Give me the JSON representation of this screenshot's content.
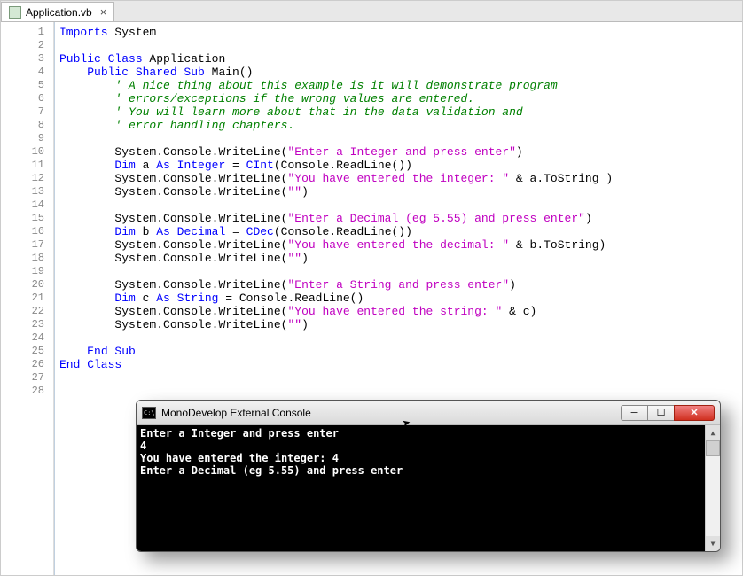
{
  "tab": {
    "filename": "Application.vb",
    "close_symbol": "×"
  },
  "line_numbers": [
    "1",
    "2",
    "3",
    "4",
    "5",
    "6",
    "7",
    "8",
    "9",
    "10",
    "11",
    "12",
    "13",
    "14",
    "15",
    "16",
    "17",
    "18",
    "19",
    "20",
    "21",
    "22",
    "23",
    "24",
    "25",
    "26",
    "27",
    "28"
  ],
  "code": {
    "l1": {
      "kw1": "Imports",
      "p1": " System"
    },
    "l3": {
      "kw1": "Public Class",
      "p1": " Application"
    },
    "l4": {
      "indent": "    ",
      "kw1": "Public Shared Sub",
      "p1": " Main()"
    },
    "l5": {
      "indent": "        ",
      "cm": "' A nice thing about this example is it will demonstrate program"
    },
    "l6": {
      "indent": "        ",
      "cm": "' errors/exceptions if the wrong values are entered."
    },
    "l7": {
      "indent": "        ",
      "cm": "' You will learn more about that in the data validation and"
    },
    "l8": {
      "indent": "        ",
      "cm": "' error handling chapters."
    },
    "l10": {
      "indent": "        ",
      "p1": "System.Console.WriteLine(",
      "s1": "\"Enter a Integer and press enter\"",
      "p2": ")"
    },
    "l11": {
      "indent": "        ",
      "kw1": "Dim",
      "p1": " a ",
      "kw2": "As Integer",
      "p2": " = ",
      "kw3": "CInt",
      "p3": "(Console.ReadLine())"
    },
    "l12": {
      "indent": "        ",
      "p1": "System.Console.WriteLine(",
      "s1": "\"You have entered the integer: \"",
      "p2": " & a.ToString )"
    },
    "l13": {
      "indent": "        ",
      "p1": "System.Console.WriteLine(",
      "s1": "\"\"",
      "p2": ")"
    },
    "l15": {
      "indent": "        ",
      "p1": "System.Console.WriteLine(",
      "s1": "\"Enter a Decimal (eg 5.55) and press enter\"",
      "p2": ")"
    },
    "l16": {
      "indent": "        ",
      "kw1": "Dim",
      "p1": " b ",
      "kw2": "As Decimal",
      "p2": " = ",
      "kw3": "CDec",
      "p3": "(Console.ReadLine())"
    },
    "l17": {
      "indent": "        ",
      "p1": "System.Console.WriteLine(",
      "s1": "\"You have entered the decimal: \"",
      "p2": " & b.ToString)"
    },
    "l18": {
      "indent": "        ",
      "p1": "System.Console.WriteLine(",
      "s1": "\"\"",
      "p2": ")"
    },
    "l20": {
      "indent": "        ",
      "p1": "System.Console.WriteLine(",
      "s1": "\"Enter a String and press enter\"",
      "p2": ")"
    },
    "l21": {
      "indent": "        ",
      "kw1": "Dim",
      "p1": " c ",
      "kw2": "As String",
      "p2": " = Console.ReadLine()"
    },
    "l22": {
      "indent": "        ",
      "p1": "System.Console.WriteLine(",
      "s1": "\"You have entered the string: \"",
      "p2": " & c)"
    },
    "l23": {
      "indent": "        ",
      "p1": "System.Console.WriteLine(",
      "s1": "\"\"",
      "p2": ")"
    },
    "l25": {
      "indent": "    ",
      "kw1": "End Sub"
    },
    "l26": {
      "kw1": "End Class"
    }
  },
  "console": {
    "icon_text": "C:\\",
    "title": "MonoDevelop External Console",
    "lines": [
      "Enter a Integer and press enter",
      "4",
      "You have entered the integer: 4",
      "",
      "Enter a Decimal (eg 5.55) and press enter"
    ],
    "min_symbol": "─",
    "max_symbol": "☐",
    "close_symbol": "✕",
    "scroll_up": "▲",
    "scroll_down": "▼"
  }
}
